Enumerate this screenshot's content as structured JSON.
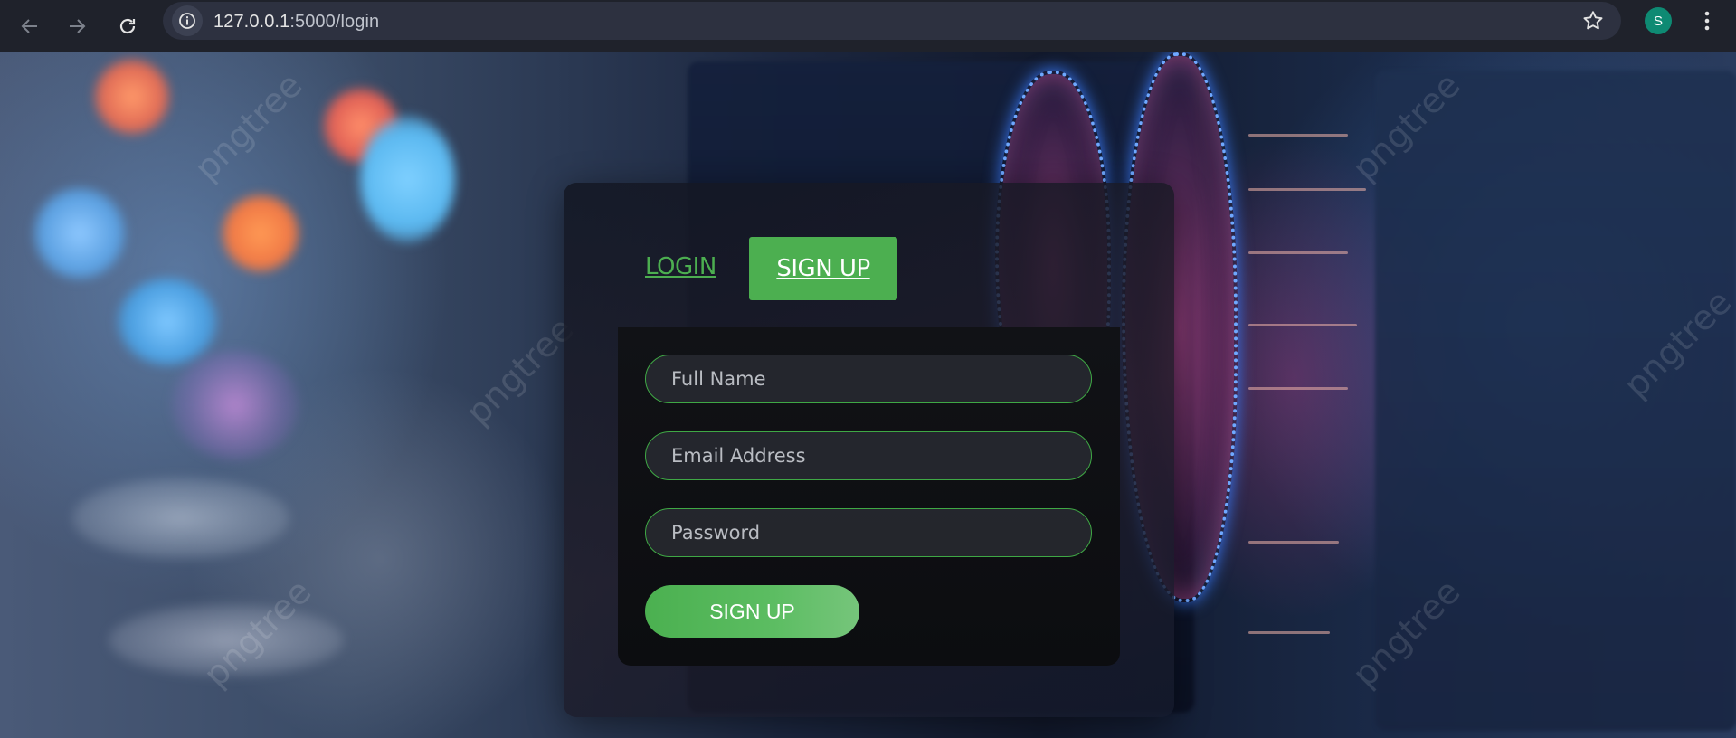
{
  "browser": {
    "url_host": "127.0.0.1",
    "url_rest": ":5000/login",
    "profile_initial": "S"
  },
  "auth": {
    "tabs": {
      "login_label": "LOGIN",
      "signup_label": "SIGN UP"
    },
    "form": {
      "full_name_placeholder": "Full Name",
      "email_placeholder": "Email Address",
      "password_placeholder": "Password",
      "submit_label": "SIGN UP"
    }
  },
  "background": {
    "watermark_text": "pngtree"
  },
  "colors": {
    "accent_green": "#4caf50",
    "field_border": "#3fa845"
  }
}
